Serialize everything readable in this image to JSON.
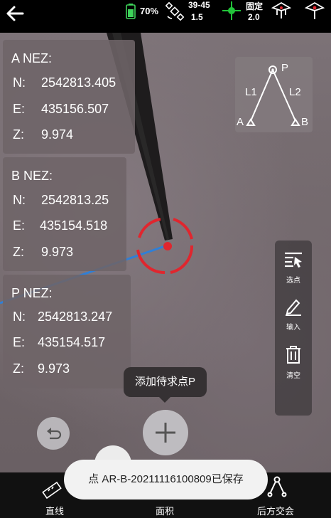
{
  "status_bar": {
    "battery_percent": "70%",
    "satellites": "39-45",
    "satellite_sub": "1.5",
    "fix_status": "固定",
    "fix_sub": "2.0"
  },
  "points": {
    "a": {
      "title": "A NEZ:",
      "n_label": "N:",
      "n_value": "2542813.405",
      "e_label": "E:",
      "e_value": "435156.507",
      "z_label": "Z:",
      "z_value": "9.974"
    },
    "b": {
      "title": "B NEZ:",
      "n_label": "N:",
      "n_value": "2542813.25",
      "e_label": "E:",
      "e_value": "435154.518",
      "z_label": "Z:",
      "z_value": "9.973"
    },
    "p": {
      "title": "P NEZ:",
      "n_label": "N:",
      "n_value": "2542813.247",
      "e_label": "E:",
      "e_value": "435154.517",
      "z_label": "Z:",
      "z_value": "9.973"
    }
  },
  "diagram": {
    "p": "P",
    "l1": "L1",
    "l2": "L2",
    "a": "A",
    "b": "B"
  },
  "tools": {
    "select_label": "选点",
    "input_label": "输入",
    "clear_label": "清空"
  },
  "tooltip": "添加待求点P",
  "toast": "点 AR-B-20211116100809已保存",
  "tabs": {
    "line": "直线",
    "area": "面积",
    "resection": "后方交会"
  },
  "colors": {
    "accent_red": "#e0262e",
    "measure_blue": "#2f7fd6",
    "fix_green": "#22c43a",
    "battery_green": "#3ed35a"
  }
}
